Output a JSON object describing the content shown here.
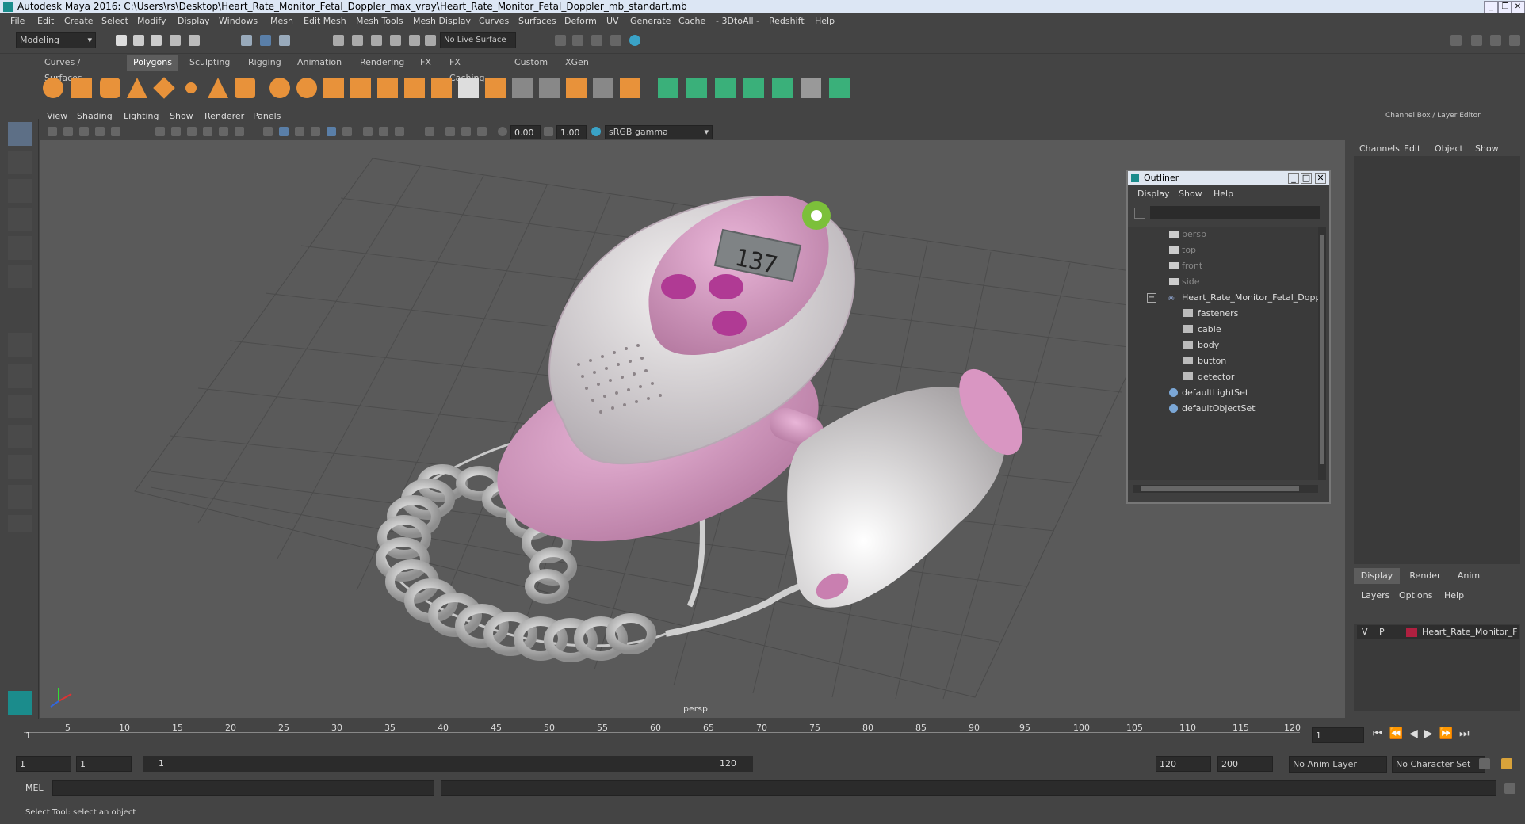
{
  "window": {
    "title": "Autodesk Maya 2016: C:\\Users\\rs\\Desktop\\Heart_Rate_Monitor_Fetal_Doppler_max_vray\\Heart_Rate_Monitor_Fetal_Doppler_mb_standart.mb"
  },
  "menubar": [
    "File",
    "Edit",
    "Create",
    "Select",
    "Modify",
    "Display",
    "Windows",
    "Mesh",
    "Edit Mesh",
    "Mesh Tools",
    "Mesh Display",
    "Curves",
    "Surfaces",
    "Deform",
    "UV",
    "Generate",
    "Cache",
    "- 3DtoAll -",
    "Redshift",
    "Help"
  ],
  "status": {
    "mode": "Modeling",
    "live_surface": "No Live Surface"
  },
  "shelf_tabs": [
    "Curves / Surfaces",
    "Polygons",
    "Sculpting",
    "Rigging",
    "Animation",
    "Rendering",
    "FX",
    "FX Caching",
    "Custom",
    "XGen"
  ],
  "shelf_active": "Polygons",
  "viewport": {
    "menu": [
      "View",
      "Shading",
      "Lighting",
      "Show",
      "Renderer",
      "Panels"
    ],
    "exposure": "0.00",
    "gamma": "1.00",
    "color_space": "sRGB gamma",
    "camera_label": "persp",
    "display_reading": "137"
  },
  "outliner": {
    "title": "Outliner",
    "menu": [
      "Display",
      "Show",
      "Help"
    ],
    "items": [
      {
        "label": "persp",
        "dim": true
      },
      {
        "label": "top",
        "dim": true
      },
      {
        "label": "front",
        "dim": true
      },
      {
        "label": "side",
        "dim": true
      },
      {
        "label": "Heart_Rate_Monitor_Fetal_Doppl",
        "dim": false
      },
      {
        "label": "fasteners",
        "dim": false
      },
      {
        "label": "cable",
        "dim": false
      },
      {
        "label": "body",
        "dim": false
      },
      {
        "label": "button",
        "dim": false
      },
      {
        "label": "detector",
        "dim": false
      },
      {
        "label": "defaultLightSet",
        "dim": false
      },
      {
        "label": "defaultObjectSet",
        "dim": false
      }
    ]
  },
  "channel_box": {
    "title": "Channel Box / Layer Editor",
    "menu": [
      "Channels",
      "Edit",
      "Object",
      "Show"
    ],
    "layer_tabs": [
      "Display",
      "Render",
      "Anim"
    ],
    "layer_menu": [
      "Layers",
      "Options",
      "Help"
    ],
    "layer": {
      "v": "V",
      "p": "P",
      "name": "Heart_Rate_Monitor_F",
      "color": "#b02040"
    }
  },
  "timeline": {
    "ticks": [
      "1",
      "5",
      "10",
      "15",
      "20",
      "25",
      "30",
      "35",
      "40",
      "45",
      "50",
      "55",
      "60",
      "65",
      "70",
      "75",
      "80",
      "85",
      "90",
      "95",
      "100",
      "105",
      "110",
      "115",
      "120"
    ],
    "current_frame": "1"
  },
  "range": {
    "start": "1",
    "start2": "1",
    "slider_start": "1",
    "slider_end": "120",
    "end": "120",
    "end2": "200",
    "anim_layer": "No Anim Layer",
    "char_set": "No Character Set"
  },
  "mel": {
    "label": "MEL"
  },
  "help_line": "Select Tool: select an object",
  "colors": {
    "bg": "#444444",
    "viewport": "#5a5a5a",
    "accent": "#5d5d5d"
  }
}
